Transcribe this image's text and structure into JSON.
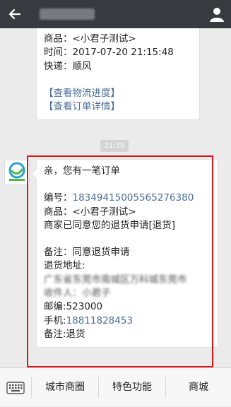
{
  "header": {
    "back_icon": "arrow-left-icon",
    "user_icon": "user-icon"
  },
  "message1": {
    "product": "商品：<小君子测试>",
    "time": "时间：2017-07-20 21:15:48",
    "express": "快递：顺风",
    "link_logistics": "【查看物流进度】",
    "link_order": "【查看订单详情】"
  },
  "timestamp": "21:30",
  "message2": {
    "greeting": "亲，您有一笔订单",
    "order_no_label": "编号：",
    "order_no": "18349415005565276380",
    "product": "商品：<小君子测试>",
    "status": "商家已同意您的退货申请[退货]",
    "remark": "备注：同意退货申请",
    "return_address_label": "退货地址:",
    "address_line1": "广东省东莞市南城区万科城东莞市",
    "address_line2": "收件人：小君子",
    "postcode_label": "邮编:",
    "postcode": "523000",
    "phone_label": "手机:",
    "phone": "18811828453",
    "remark2": "备注:退货"
  },
  "bottombar": {
    "keyboard_icon": "keyboard-icon",
    "tabs": [
      "城市商圈",
      "特色功能",
      "商城"
    ]
  }
}
